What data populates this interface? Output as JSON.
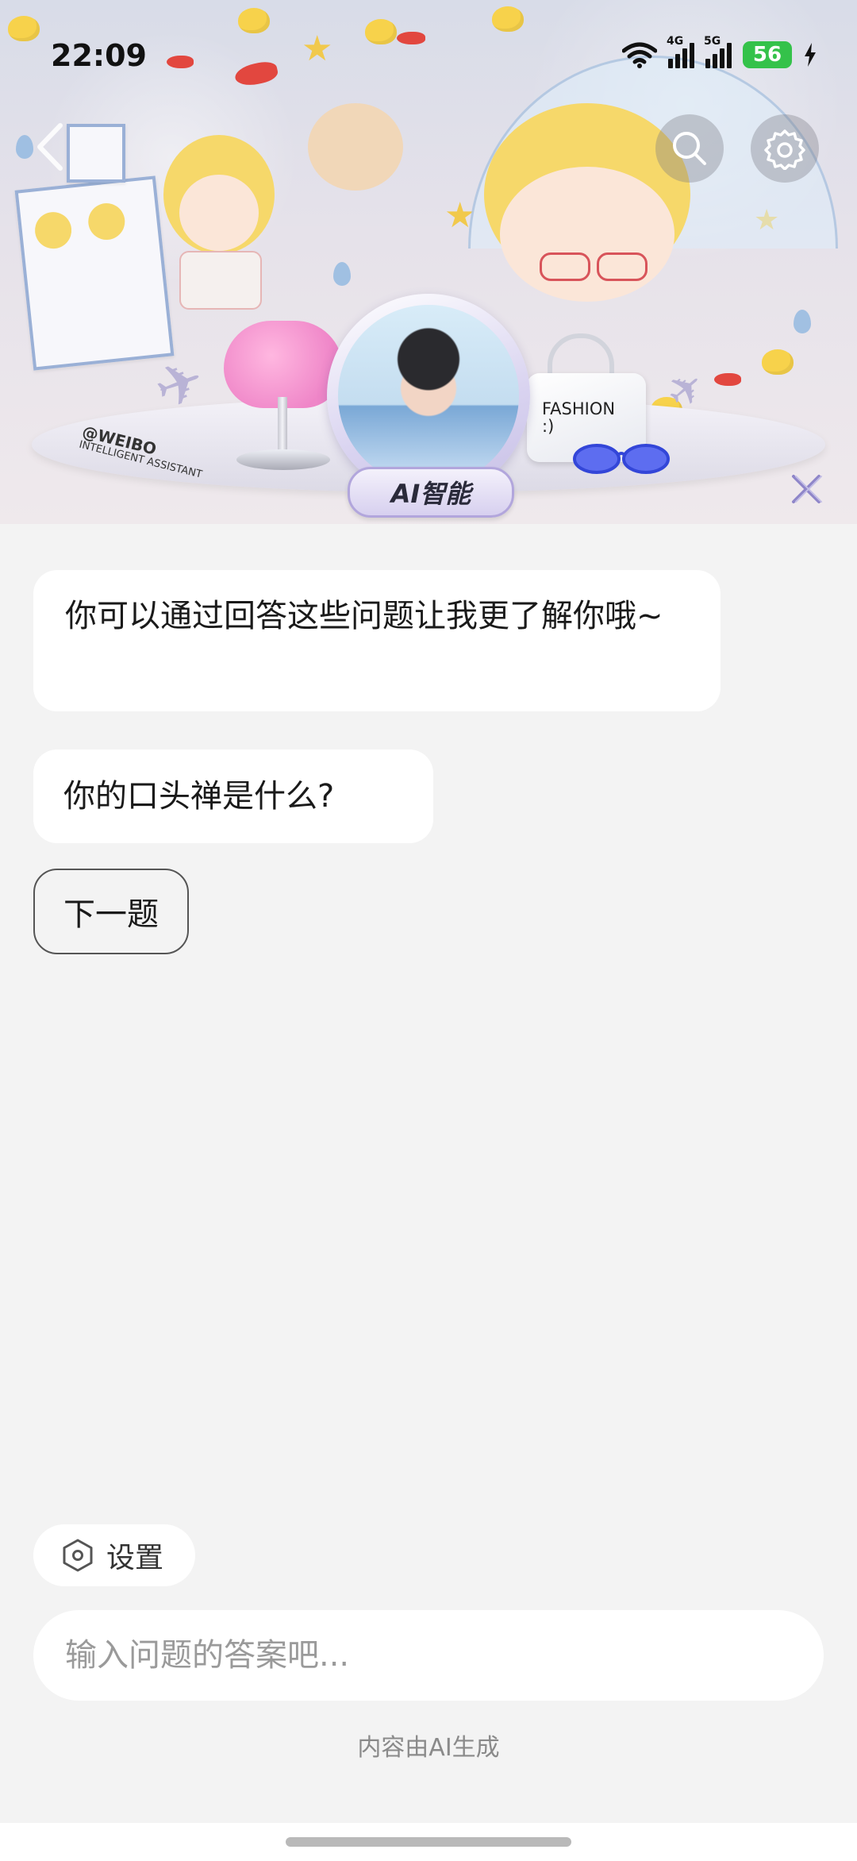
{
  "status_bar": {
    "time": "22:09",
    "network_1": "4G",
    "network_2": "5G",
    "battery": "56"
  },
  "header": {
    "back_icon": "chevron-left-icon",
    "search_icon": "search-icon",
    "settings_icon": "gear-icon",
    "close_icon": "close-icon",
    "weibo_tag_line1": "@WEIBO",
    "weibo_tag_line2": "INTELLIGENT ASSISTANT",
    "ai_badge": "AI智能",
    "fashion_line1": "FASHION",
    "fashion_line2": ":)"
  },
  "chat": {
    "intro": "你可以通过回答这些问题让我更了解你哦~",
    "question": "你的口头禅是什么?",
    "next_button": "下一题"
  },
  "footer": {
    "settings_label": "设置",
    "input_placeholder": "输入问题的答案吧...",
    "ai_note": "内容由AI生成"
  },
  "colors": {
    "background": "#f3f3f3",
    "bubble": "#ffffff",
    "battery": "#34c24a",
    "ai_badge_border": "#b2a6dc",
    "close_icon": "#8f86c9"
  }
}
